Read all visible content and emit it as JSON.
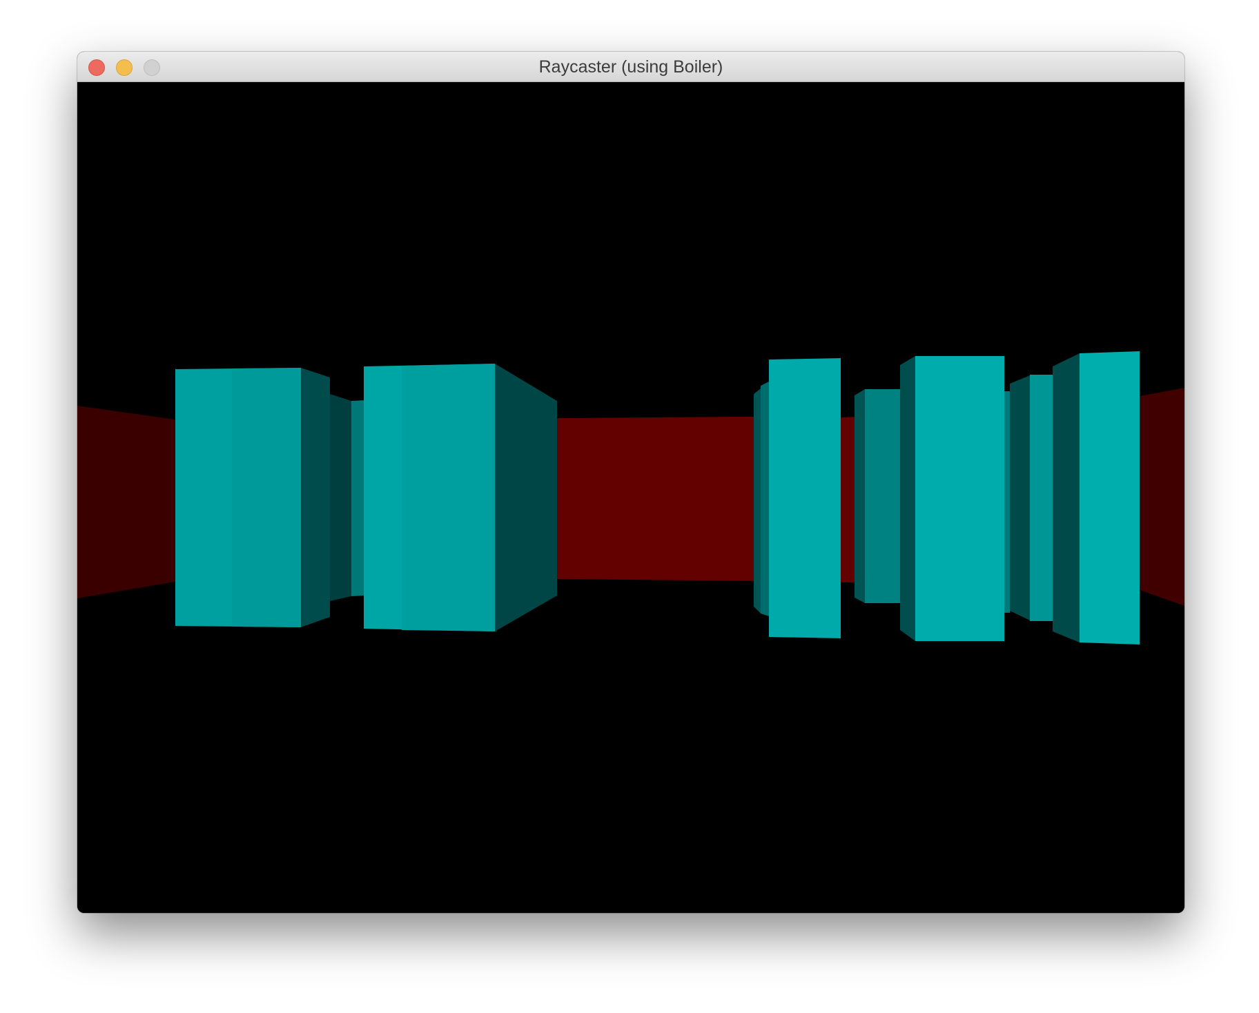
{
  "window": {
    "title": "Raycaster (using Boiler)"
  },
  "icons": {
    "close": "close-button-icon",
    "minimize": "minimize-button-icon",
    "zoom": "zoom-button-icon"
  },
  "colors": {
    "background": "#000000",
    "wall_red_bright": "#630000",
    "wall_red_dim": "#3a0000",
    "wall_cyan_face": "#00a7a7",
    "wall_cyan_mid": "#008080",
    "wall_cyan_side": "#004848"
  }
}
